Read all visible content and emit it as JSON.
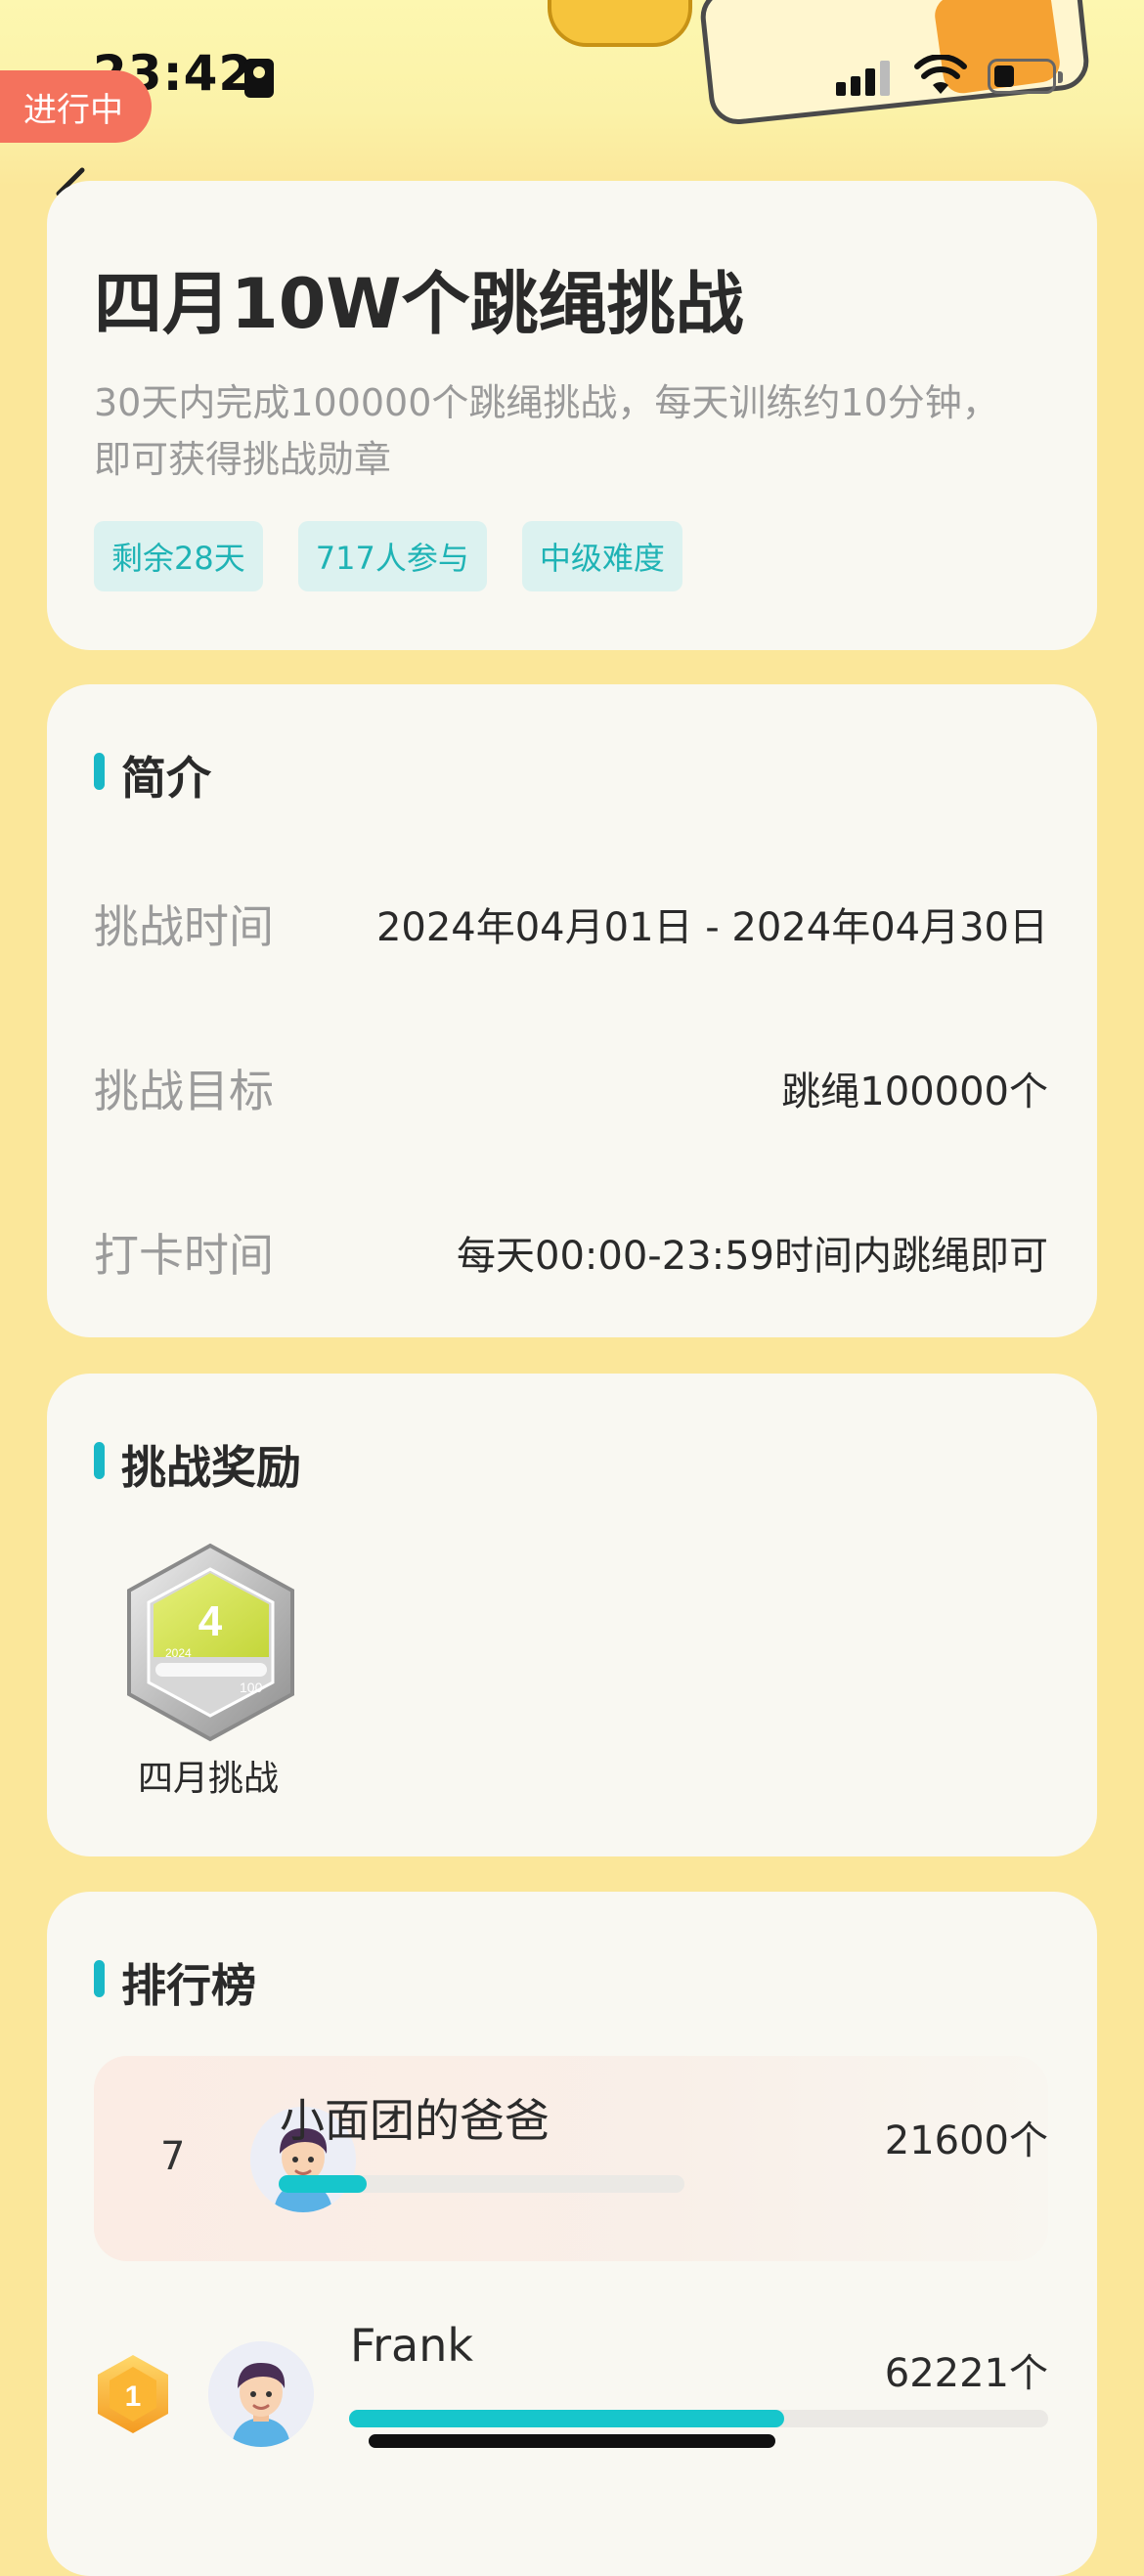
{
  "status_bar": {
    "time": "23:42"
  },
  "header": {
    "status_label": "进行中"
  },
  "challenge": {
    "title": "四月10W个跳绳挑战",
    "description": "30天内完成100000个跳绳挑战，每天训练约10分钟，即可获得挑战勋章",
    "tags": [
      "剩余28天",
      "717人参与",
      "中级难度"
    ]
  },
  "intro": {
    "title": "简介",
    "rows": [
      {
        "label": "挑战时间",
        "value": "2024年04月01日 - 2024年04月30日"
      },
      {
        "label": "挑战目标",
        "value": "跳绳100000个"
      },
      {
        "label": "打卡时间",
        "value": "每天00:00-23:59时间内跳绳即可"
      }
    ]
  },
  "reward": {
    "title": "挑战奖励",
    "medal_name": "四月挑战",
    "medal_glyph": "4",
    "medal_text_left": "2024",
    "medal_text_right": "100"
  },
  "leaderboard": {
    "title": "排行榜",
    "my_entry": {
      "rank": "7",
      "name": "小面团的爸爸",
      "count": "21600个",
      "progress": 0.216
    },
    "entries": [
      {
        "rank": "1",
        "name": "Frank",
        "count": "62221个",
        "progress": 0.622
      }
    ]
  }
}
